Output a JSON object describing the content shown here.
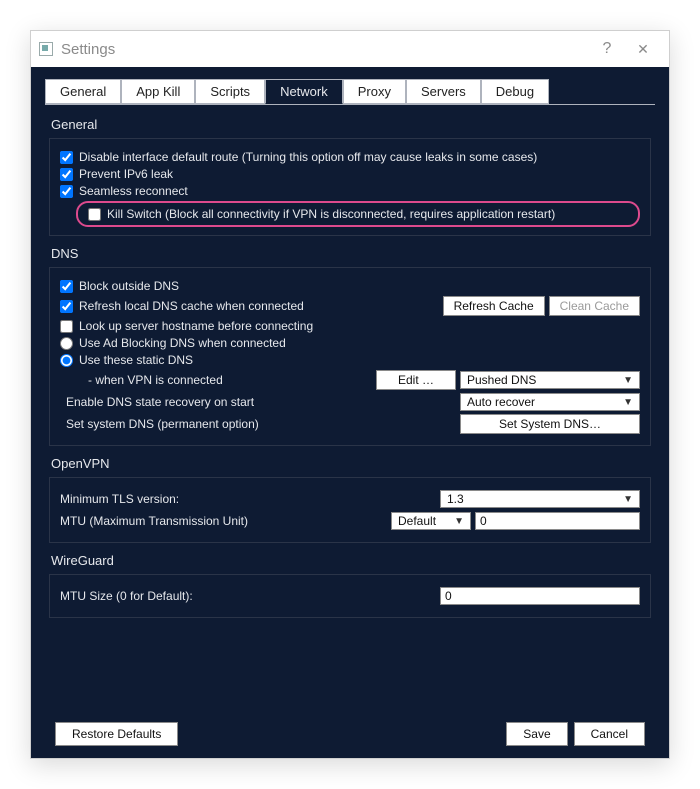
{
  "window": {
    "title": "Settings",
    "help_icon": "?",
    "close_icon": "✕"
  },
  "tabs": [
    "General",
    "App Kill",
    "Scripts",
    "Network",
    "Proxy",
    "Servers",
    "Debug"
  ],
  "active_tab_index": 3,
  "sections": {
    "general": {
      "title": "General",
      "disable_route_label": "Disable interface default route (Turning this option off may cause leaks in some cases)",
      "disable_route_checked": true,
      "ipv6_label": "Prevent IPv6 leak",
      "ipv6_checked": true,
      "seamless_label": "Seamless reconnect",
      "seamless_checked": true,
      "killswitch_label": "Kill Switch (Block all connectivity if VPN is disconnected, requires application restart)",
      "killswitch_checked": false
    },
    "dns": {
      "title": "DNS",
      "block_label": "Block outside DNS",
      "block_checked": true,
      "refresh_label": "Refresh local DNS cache when connected",
      "refresh_checked": true,
      "refresh_btn": "Refresh Cache",
      "clean_btn": "Clean Cache",
      "lookup_label": "Look up server hostname before connecting",
      "lookup_checked": false,
      "adblock_label": "Use Ad Blocking DNS when connected",
      "adblock_selected": false,
      "static_label": "Use these static DNS",
      "static_selected": true,
      "when_label": " - when VPN is connected",
      "edit_btn": "Edit …",
      "pushed_select": "Pushed DNS",
      "recovery_label": "Enable DNS state recovery on start",
      "recovery_select": "Auto recover",
      "setsys_label": "Set system DNS (permanent option)",
      "setsys_btn": "Set System DNS…"
    },
    "openvpn": {
      "title": "OpenVPN",
      "tls_label": "Minimum TLS version:",
      "tls_select": "1.3",
      "mtu_label": "MTU (Maximum Transmission Unit)",
      "mtu_select": "Default",
      "mtu_value": "0"
    },
    "wireguard": {
      "title": "WireGuard",
      "mtu_label": "MTU Size (0 for Default):",
      "mtu_value": "0"
    }
  },
  "footer": {
    "restore": "Restore Defaults",
    "save": "Save",
    "cancel": "Cancel"
  }
}
